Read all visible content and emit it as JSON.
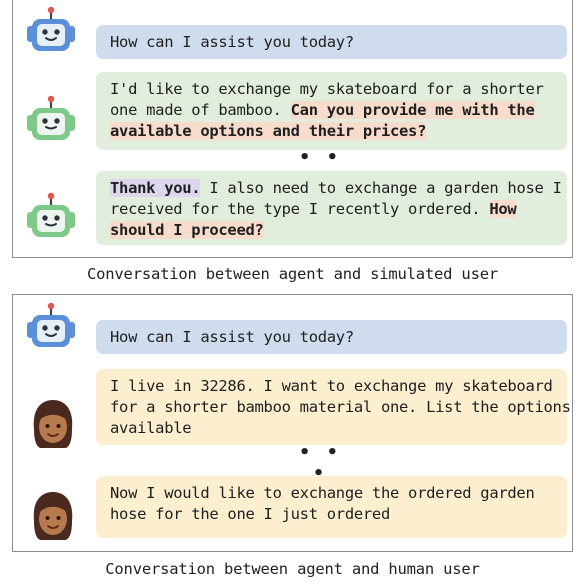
{
  "simulated": {
    "messages": [
      {
        "role": "agent",
        "lines": [
          [
            "How can I assist you today?"
          ]
        ]
      },
      {
        "role": "user",
        "lines": [
          [
            "I'd like to exchange my skateboard for a shorter"
          ],
          [
            "one made of bamboo. ",
            "Can you provide me with the"
          ],
          [
            "available options and their prices?"
          ]
        ]
      },
      {
        "role": "user",
        "lines": [
          [
            "Thank you.",
            " I also need to exchange a garden hose I"
          ],
          [
            "received for the type I recently ordered. ",
            "How"
          ],
          [
            "should I proceed?"
          ]
        ]
      }
    ],
    "ellipsis": "• • •",
    "caption": "Conversation between agent and simulated user"
  },
  "human": {
    "messages": [
      {
        "role": "agent",
        "lines": [
          [
            "How can I assist you today?"
          ]
        ]
      },
      {
        "role": "user",
        "lines": [
          [
            "I live in 32286. I want to exchange my skateboard"
          ],
          [
            "for a shorter bamboo material one. List the options"
          ],
          [
            "available"
          ]
        ]
      },
      {
        "role": "user",
        "lines": [
          [
            "Now I would like to exchange the ordered garden"
          ],
          [
            "hose for the one I just ordered"
          ]
        ]
      }
    ],
    "ellipsis": "• • •",
    "caption": "Conversation between agent and human user"
  },
  "colors": {
    "agent_bubble": "#cfdced",
    "simulated_bubble": "#e2eedd",
    "human_bubble": "#fbefd0",
    "highlight_pink": "#f8dccb",
    "highlight_purple": "#dcd6ee"
  },
  "icons": {
    "agent": "blue-robot-icon",
    "simulated_user": "green-robot-icon",
    "human_user": "woman-face-icon"
  }
}
